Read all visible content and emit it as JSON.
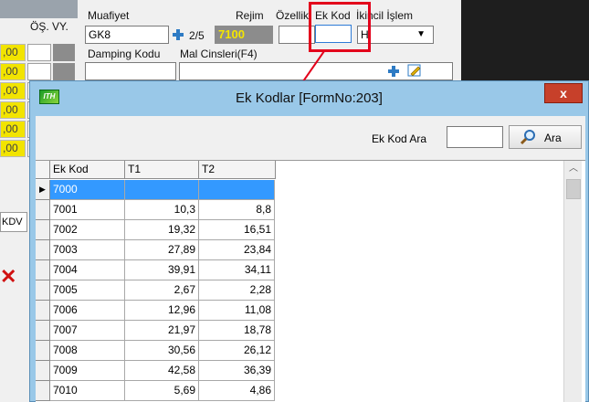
{
  "background": {
    "left_col_header": "ÖŞ. VY.",
    "left_yellow_values": [
      ",00",
      ",00",
      ",00",
      ",00",
      ",00",
      ",00"
    ],
    "kdv_label": "KDV",
    "muafiyet_label": "Muafiyet",
    "muafiyet_value": "GK8",
    "page_indicator": "2/5",
    "rejim_label": "Rejim",
    "rejim_value": "7100",
    "ozellik_label": "Özellik",
    "ek_kod_label": "Ek Kod",
    "ikincil_islem_label": "İkincil İşlem",
    "ikincil_value": "H",
    "damping_kodu_label": "Damping Kodu",
    "mal_cinsleri_label": "Mal Cinsleri(F4)"
  },
  "dialog": {
    "title": "Ek Kodlar [FormNo:203]",
    "close_label": "x",
    "icon_text": "ITH",
    "search_label": "Ek Kod Ara",
    "search_value": "",
    "search_button": "Ara",
    "columns": [
      "Ek Kod",
      "T1",
      "T2"
    ],
    "rows": [
      {
        "kod": "7000",
        "t1": "",
        "t2": "",
        "selected": true
      },
      {
        "kod": "7001",
        "t1": "10,3",
        "t2": "8,8"
      },
      {
        "kod": "7002",
        "t1": "19,32",
        "t2": "16,51"
      },
      {
        "kod": "7003",
        "t1": "27,89",
        "t2": "23,84"
      },
      {
        "kod": "7004",
        "t1": "39,91",
        "t2": "34,11"
      },
      {
        "kod": "7005",
        "t1": "2,67",
        "t2": "2,28"
      },
      {
        "kod": "7006",
        "t1": "12,96",
        "t2": "11,08"
      },
      {
        "kod": "7007",
        "t1": "21,97",
        "t2": "18,78"
      },
      {
        "kod": "7008",
        "t1": "30,56",
        "t2": "26,12"
      },
      {
        "kod": "7009",
        "t1": "42,58",
        "t2": "36,39"
      },
      {
        "kod": "7010",
        "t1": "5,69",
        "t2": "4,86"
      }
    ]
  },
  "colors": {
    "annotation": "#e3001b",
    "selection": "#3399ff",
    "dialog_frame": "#99c8e8",
    "close_button": "#c7402a",
    "rejim_text": "#f4e600"
  }
}
